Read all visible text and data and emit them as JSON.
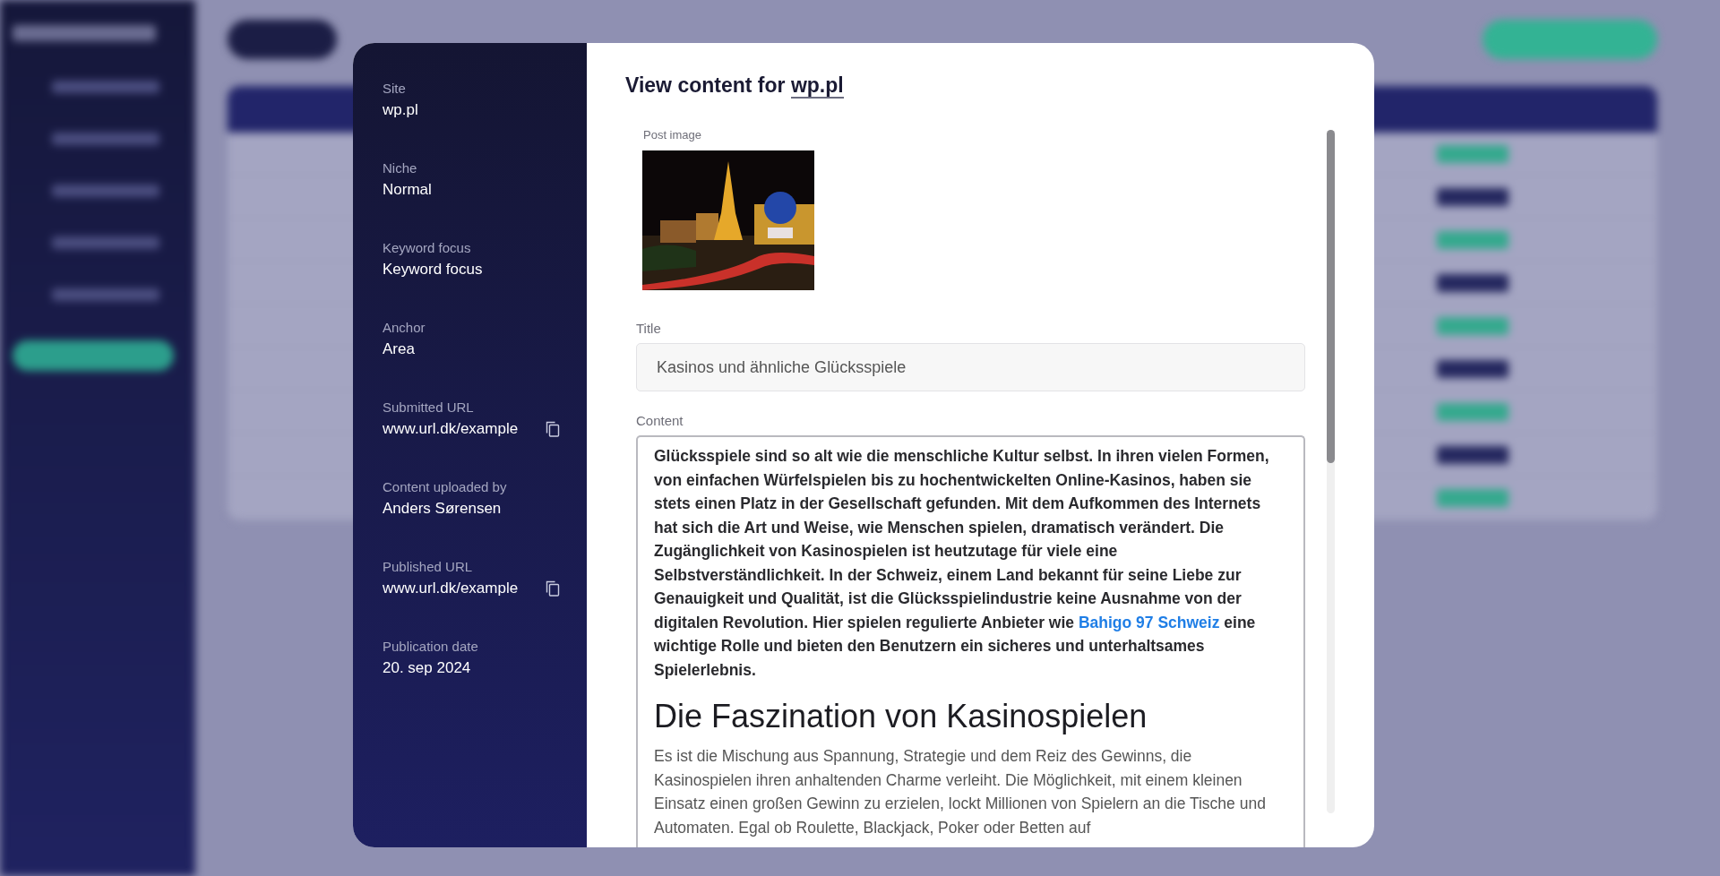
{
  "details": [
    {
      "label": "Site",
      "value": "wp.pl",
      "copyable": false
    },
    {
      "label": "Niche",
      "value": "Normal",
      "copyable": false
    },
    {
      "label": "Keyword focus",
      "value": "Keyword focus",
      "copyable": false
    },
    {
      "label": "Anchor",
      "value": "Area",
      "copyable": false
    },
    {
      "label": "Submitted URL",
      "value": "www.url.dk/example",
      "copyable": true
    },
    {
      "label": "Content uploaded by",
      "value": "Anders Sørensen",
      "copyable": false
    },
    {
      "label": "Published URL",
      "value": "www.url.dk/example",
      "copyable": true
    },
    {
      "label": "Publication date",
      "value": "20. sep 2024",
      "copyable": false
    }
  ],
  "dialog": {
    "title": "View content for",
    "site_link": "wp.pl",
    "post_image": {
      "label": "Post image",
      "kind": "picture"
    },
    "title_field": {
      "label": "Title",
      "value": "Kasinos und ähnliche Glücksspiele"
    },
    "content": {
      "label": "Content",
      "blocks": [
        {
          "kind": "lead",
          "text": "Glücksspiele sind so alt wie die menschliche Kultur selbst. In ihren vielen Formen, von einfachen Würfelspielen bis zu hochentwickelten Online-Kasinos, haben sie stets einen Platz in der Gesellschaft gefunden. Mit dem Aufkommen des Internets hat sich die Art und Weise, wie Menschen spielen, dramatisch verändert. Die Zugänglichkeit von Kasinospielen ist heutzutage für viele eine Selbstverständlichkeit. In der Schweiz, einem Land bekannt für seine Liebe zur Genauigkeit und Qualität, ist die Glücksspielindustrie keine Ausnahme von der digitalen Revolution. Hier spielen regulierte Anbieter wie",
          "link": "Bahigo 97 Schweiz",
          "text_after": "eine wichtige Rolle und bieten den Benutzern ein sicheres und unterhaltsames Spielerlebnis."
        },
        {
          "kind": "heading",
          "text": "Die Faszination von Kasinospielen"
        },
        {
          "kind": "paragraph",
          "text": "Es ist die Mischung aus Spannung, Strategie und dem Reiz des Gewinns, die Kasinospielen ihren anhaltenden Charme verleiht. Die Möglichkeit, mit einem kleinen Einsatz einen großen Gewinn zu erzielen, lockt Millionen von Spielern an die Tische und Automaten. Egal ob Roulette, Blackjack, Poker oder Betten auf"
        }
      ]
    }
  }
}
